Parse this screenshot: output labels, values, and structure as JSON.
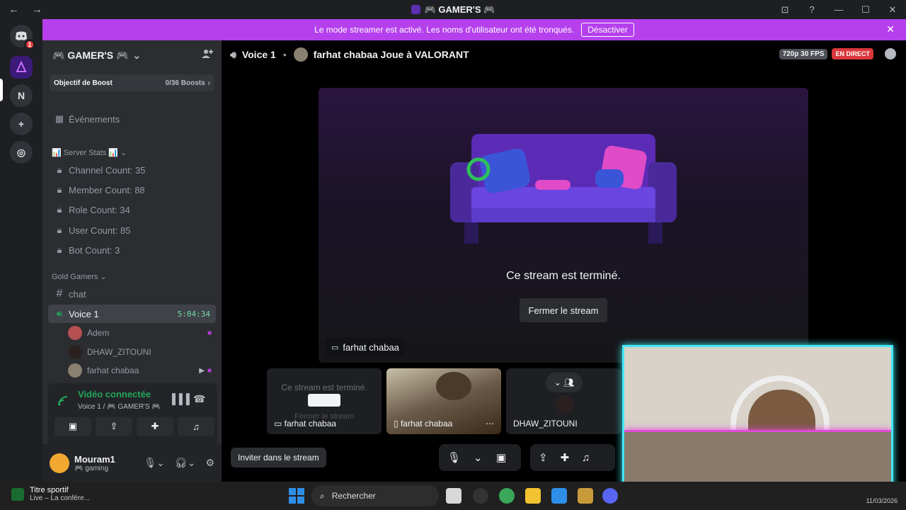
{
  "window": {
    "title": "🎮 GAMER'S 🎮",
    "nav_back": "←",
    "nav_fwd": "→",
    "controls": [
      "⊡",
      "?",
      "—",
      "☐",
      "✕"
    ]
  },
  "guilds": {
    "badge": "1",
    "letter_server": "N",
    "add": "+",
    "discover": "◎"
  },
  "banner": {
    "text": "Le mode streamer est activé. Les noms d'utilisateur ont été tronqués.",
    "button": "Désactiver",
    "close": "✕"
  },
  "sidebar": {
    "server_name": "🎮 GAMER'S 🎮",
    "chevron": "⌄",
    "boost_label": "Objectif de Boost",
    "boost_count": "0/36 Boosts",
    "boost_arrow": "›",
    "events": "Événements",
    "cat_stats": "📊 Server Stats 📊",
    "stats": [
      "Channel Count: 35",
      "Member Count: 88",
      "Role Count: 34",
      "User Count: 85",
      "Bot Count: 3"
    ],
    "cat_gold": "Gold Gamers",
    "chat": "chat",
    "voice": "Voice 1",
    "voice_time": "5:04:34",
    "users": [
      "Adem",
      "DHAW_ZITOUNI",
      "farhat chabaa"
    ]
  },
  "voicebar": {
    "status": "Vidéo connectée",
    "sub": "Voice 1 / 🎮 GAMER'S 🎮"
  },
  "userpanel": {
    "name": "Mouram1",
    "status": "🎮 gaming"
  },
  "main": {
    "channel": "Voice 1",
    "streamer": "farhat chabaa Joue à VALORANT",
    "quality": "720p 30 FPS",
    "live": "EN DIRECT",
    "ended": "Ce stream est terminé.",
    "close_btn": "Fermer le stream",
    "chip_name": "farhat chabaa",
    "tile1_text": "Ce stream est terminé.",
    "tile1_btn": "Fermer le stream",
    "tile1_name": "farhat chabaa",
    "tile2_name": "farhat chabaa",
    "tile3_name": "DHAW_ZITOUNI",
    "invite": "Inviter dans le stream"
  },
  "taskbar": {
    "news_title": "Titre sportif",
    "news_sub": "Live – La confére...",
    "search": "Rechercher",
    "date": "11/03/2026"
  }
}
